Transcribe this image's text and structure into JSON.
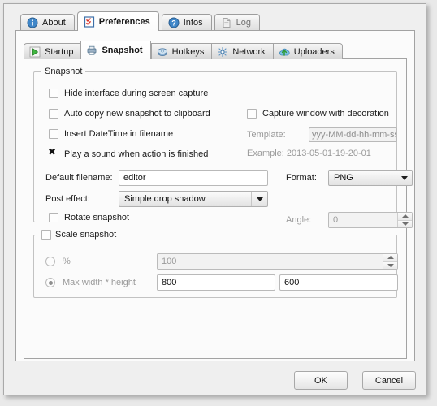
{
  "window": {
    "outer_tabs": [
      {
        "label": "About",
        "icon": "info-circle-icon",
        "active": false
      },
      {
        "label": "Preferences",
        "icon": "checklist-icon",
        "active": true
      },
      {
        "label": "Infos",
        "icon": "help-circle-icon",
        "active": false
      },
      {
        "label": "Log",
        "icon": "document-icon",
        "active": false
      }
    ],
    "inner_tabs": [
      {
        "label": "Startup",
        "icon": "green-play-icon",
        "active": false
      },
      {
        "label": "Snapshot",
        "icon": "camera-printer-icon",
        "active": true
      },
      {
        "label": "Hotkeys",
        "icon": "blue-disc-icon",
        "active": false
      },
      {
        "label": "Network",
        "icon": "network-star-icon",
        "active": false
      },
      {
        "label": "Uploaders",
        "icon": "cloud-upload-icon",
        "active": false
      }
    ]
  },
  "snapshot_group": {
    "title": "Snapshot",
    "checkboxes": {
      "hide_interface": {
        "label": "Hide interface during screen capture",
        "checked": false
      },
      "auto_copy": {
        "label": "Auto copy new snapshot to clipboard",
        "checked": false
      },
      "insert_datetime": {
        "label": "Insert DateTime in filename",
        "checked": false
      },
      "play_sound": {
        "label": "Play a sound when action is finished",
        "checked": true
      },
      "capture_decoration": {
        "label": "Capture window with decoration",
        "checked": false
      },
      "rotate_snapshot": {
        "label": "Rotate snapshot",
        "checked": false
      }
    },
    "template": {
      "label": "Template:",
      "value": "yyy-MM-dd-hh-mm-ss",
      "enabled": false
    },
    "example": "Example: 2013-05-01-19-20-01",
    "default_filename": {
      "label": "Default filename:",
      "value": "editor"
    },
    "format": {
      "label": "Format:",
      "value": "PNG"
    },
    "post_effect": {
      "label": "Post effect:",
      "value": "Simple drop shadow"
    },
    "angle": {
      "label": "Angle:",
      "value": "0",
      "enabled": false
    }
  },
  "scale_group": {
    "title": "Scale snapshot",
    "checked": false,
    "percent": {
      "label": "%",
      "selected": false,
      "value": "100"
    },
    "maxwh": {
      "label": "Max width * height",
      "selected": true,
      "width": "800",
      "height": "600"
    }
  },
  "footer": {
    "ok": "OK",
    "cancel": "Cancel"
  }
}
